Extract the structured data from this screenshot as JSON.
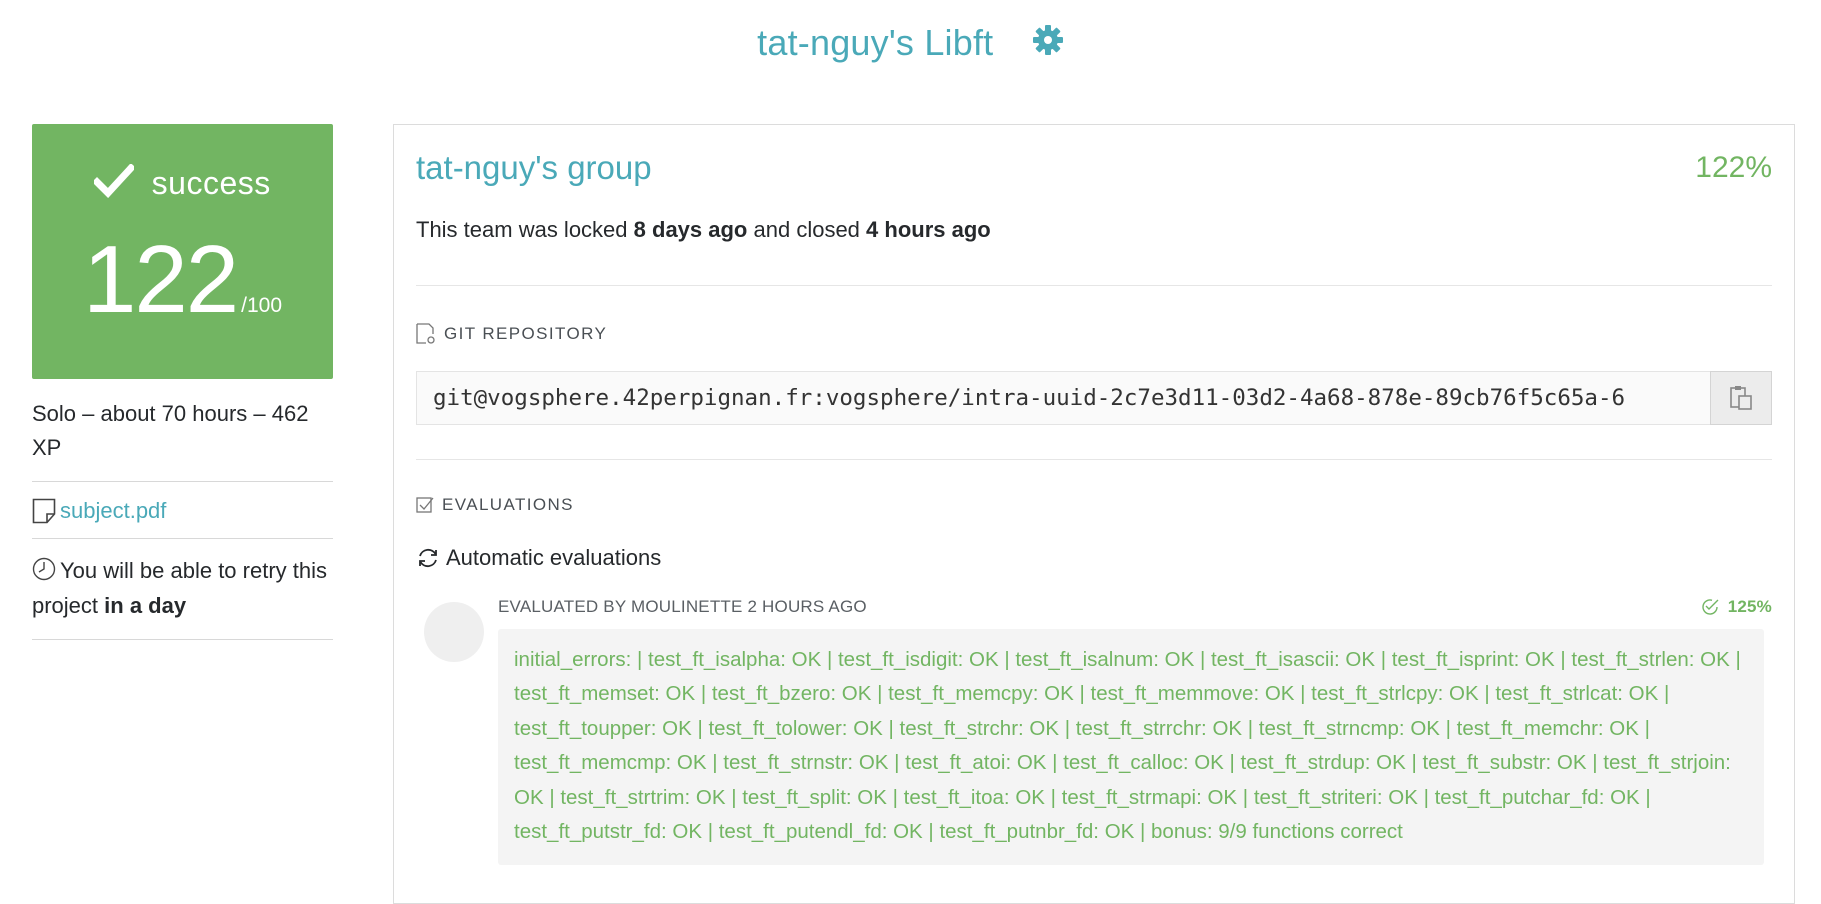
{
  "header": {
    "title": "tat-nguy's Libft",
    "settings_icon": "gear-icon",
    "accent_color": "#4aa9b8"
  },
  "score_card": {
    "status": "success",
    "mark": "122",
    "max": "/100",
    "color": "#72b562"
  },
  "project_meta": {
    "text": "Solo – about 70 hours – 462 XP"
  },
  "subject": {
    "link_text": "subject.pdf"
  },
  "retry": {
    "prefix": "You will be able to retry this project",
    "emphasis": "in a day"
  },
  "team": {
    "name": "tat-nguy's group",
    "percent": "122%",
    "lock_prefix": "This team was locked",
    "locked_ago": "8 days ago",
    "lock_middle": "and closed",
    "closed_ago": "4 hours ago"
  },
  "git": {
    "section_title": "GIT REPOSITORY",
    "url": "git@vogsphere.42perpignan.fr:vogsphere/intra-uuid-2c7e3d11-03d2-4a68-878e-89cb76f5c65a-6"
  },
  "evaluations": {
    "section_title": "EVALUATIONS",
    "auto_label": "Automatic evaluations",
    "evaluator_line": "EVALUATED BY MOULINETTE 2 HOURS AGO",
    "score": "125%",
    "details": "initial_errors: | test_ft_isalpha: OK | test_ft_isdigit: OK | test_ft_isalnum: OK | test_ft_isascii: OK | test_ft_isprint: OK | test_ft_strlen: OK | test_ft_memset: OK | test_ft_bzero: OK | test_ft_memcpy: OK | test_ft_memmove: OK | test_ft_strlcpy: OK | test_ft_strlcat: OK | test_ft_toupper: OK | test_ft_tolower: OK | test_ft_strchr: OK | test_ft_strrchr: OK | test_ft_strncmp: OK | test_ft_memchr: OK | test_ft_memcmp: OK | test_ft_strnstr: OK | test_ft_atoi: OK | test_ft_calloc: OK | test_ft_strdup: OK | test_ft_substr: OK | test_ft_strjoin: OK | test_ft_strtrim: OK | test_ft_split: OK | test_ft_itoa: OK | test_ft_strmapi: OK | test_ft_striteri: OK | test_ft_putchar_fd: OK | test_ft_putstr_fd: OK | test_ft_putendl_fd: OK | test_ft_putnbr_fd: OK | bonus: 9/9 functions correct"
  }
}
